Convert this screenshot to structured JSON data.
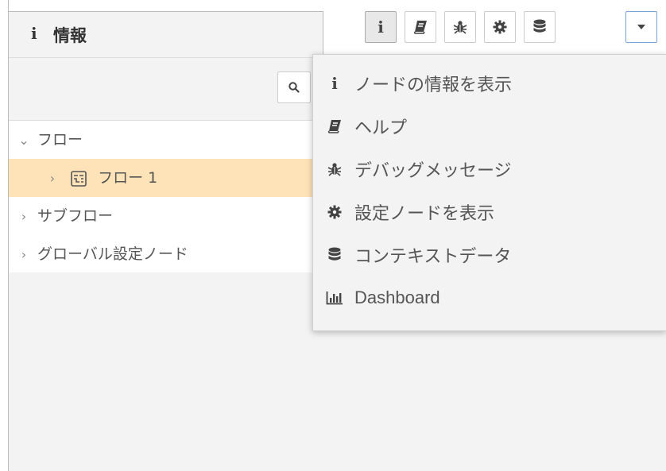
{
  "tab": {
    "icon": "info-icon",
    "label": "情報"
  },
  "toolbar": {
    "buttons": [
      {
        "icon": "info-icon"
      },
      {
        "icon": "book-icon"
      },
      {
        "icon": "bug-icon"
      },
      {
        "icon": "gear-icon"
      },
      {
        "icon": "database-icon"
      },
      {
        "icon": "caret-down-icon"
      }
    ]
  },
  "search": {
    "icon": "search-icon"
  },
  "tree": {
    "items": [
      {
        "label": "フロー",
        "expanded": true
      },
      {
        "label": "フロー 1",
        "selected": true,
        "icon": "flow-icon"
      },
      {
        "label": "サブフロー",
        "expanded": false
      },
      {
        "label": "グローバル設定ノード",
        "expanded": false
      }
    ]
  },
  "menu": {
    "items": [
      {
        "icon": "info-icon",
        "label": "ノードの情報を表示"
      },
      {
        "icon": "book-icon",
        "label": "ヘルプ"
      },
      {
        "icon": "bug-icon",
        "label": "デバッグメッセージ"
      },
      {
        "icon": "gear-icon",
        "label": "設定ノードを表示"
      },
      {
        "icon": "database-icon",
        "label": "コンテキストデータ"
      },
      {
        "icon": "bar-chart-icon",
        "label": "Dashboard"
      }
    ]
  },
  "colors": {
    "selected_row": "#ffe3b8",
    "panel_bg": "#f3f3f3",
    "dropdown_border": "#7aa4d8"
  }
}
